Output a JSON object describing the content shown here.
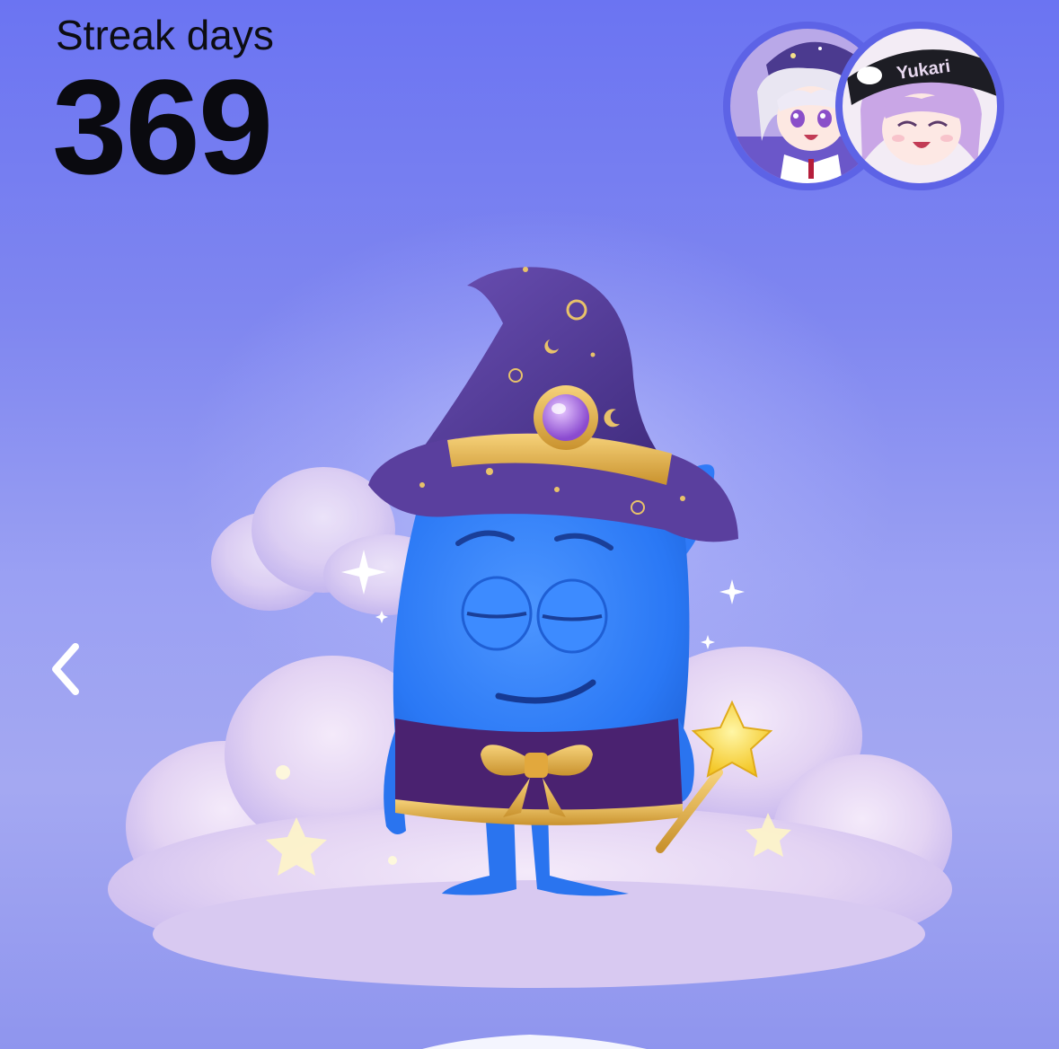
{
  "streak": {
    "label": "Streak days",
    "value": "369"
  },
  "avatars": [
    {
      "name": "friend-avatar",
      "cap_text": ""
    },
    {
      "name": "friend-avatar",
      "cap_text": "Yukari"
    }
  ],
  "colors": {
    "background_top": "#6b74f2",
    "background_mid": "#a4a8f2",
    "avatar_ring": "#5d63e6",
    "mascot_body": "#2f7bff",
    "wizard_hat": "#5a3f9e",
    "gold": "#e8b94a"
  },
  "icons": {
    "back": "chevron-left-icon"
  }
}
